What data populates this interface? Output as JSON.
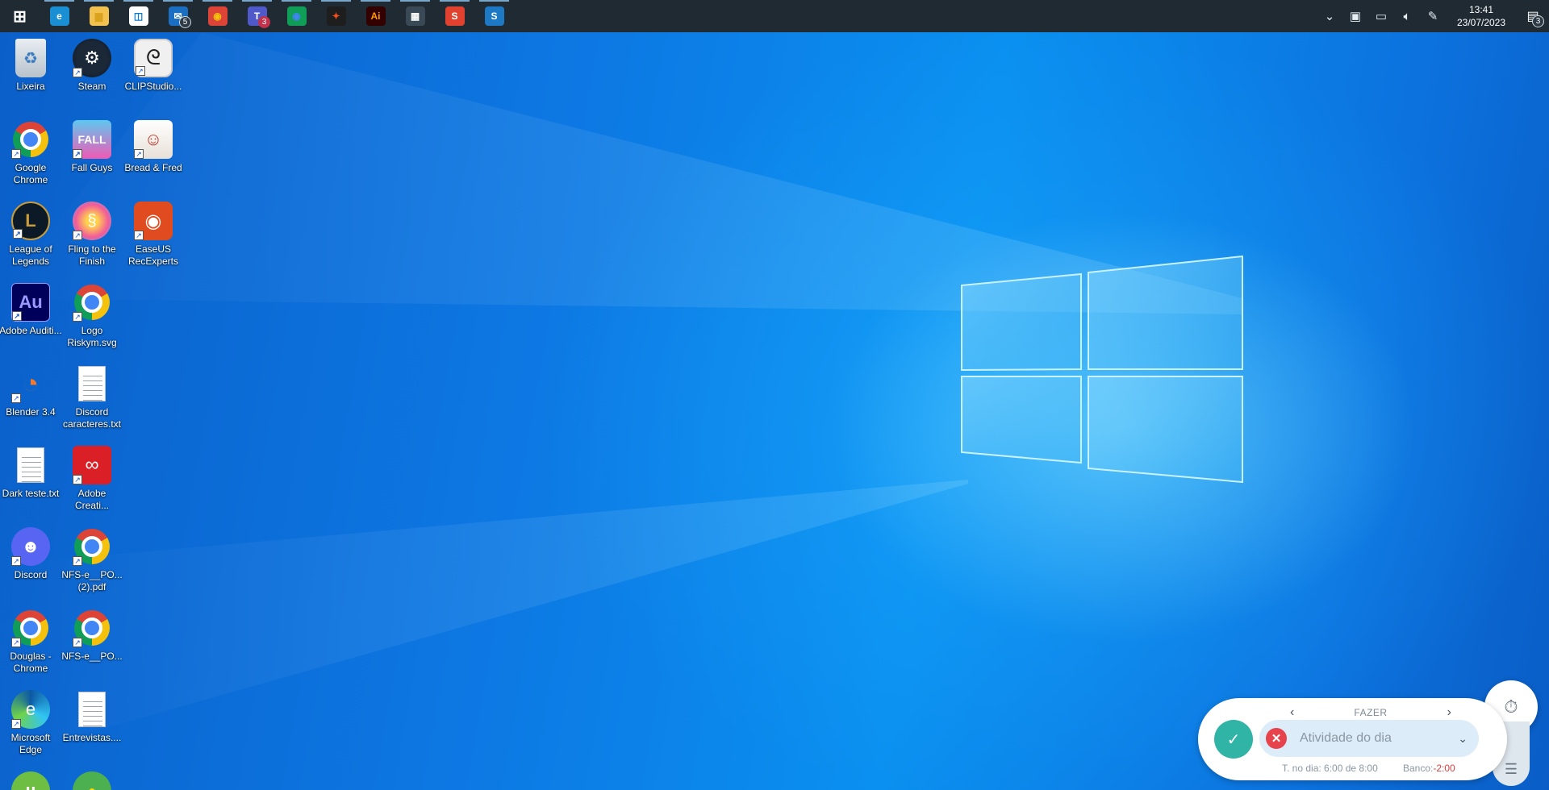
{
  "taskbar": {
    "apps": [
      {
        "name": "start-button-icon",
        "glyph": "⊞",
        "bg": "transparent",
        "color": "#ffffff"
      },
      {
        "name": "edge-icon",
        "glyph": "e",
        "bg": "#1b8fd3",
        "color": "#ffffff"
      },
      {
        "name": "file-explorer-icon",
        "glyph": "▆",
        "bg": "#f2c14e",
        "color": "#d9a21f"
      },
      {
        "name": "store-icon",
        "glyph": "◫",
        "bg": "#ffffff",
        "color": "#0078d4"
      },
      {
        "name": "mail-icon",
        "glyph": "✉",
        "bg": "#1b6fc2",
        "color": "#ffffff",
        "badge": "5"
      },
      {
        "name": "chrome-profile-icon",
        "glyph": "◉",
        "bg": "#db4437",
        "color": "#f4c20d"
      },
      {
        "name": "teams-icon",
        "glyph": "T",
        "bg": "#5059c9",
        "color": "#ffffff",
        "badge": "3",
        "badge_red": true
      },
      {
        "name": "chrome-icon",
        "glyph": "◉",
        "bg": "#0f9d58",
        "color": "#4285f4"
      },
      {
        "name": "figma-icon",
        "glyph": "✦",
        "bg": "#1e1e1e",
        "color": "#f24e1e"
      },
      {
        "name": "illustrator-icon",
        "glyph": "Ai",
        "bg": "#330000",
        "color": "#ff9a00"
      },
      {
        "name": "calculator-icon",
        "glyph": "▦",
        "bg": "#3a4956",
        "color": "#ffffff"
      },
      {
        "name": "app-s-red-icon",
        "glyph": "S",
        "bg": "#e1422f",
        "color": "#ffffff"
      },
      {
        "name": "app-s-blue-icon",
        "glyph": "S",
        "bg": "#1d79c4",
        "color": "#ffffff"
      }
    ],
    "tray": {
      "clock_time": "13:41",
      "clock_date": "23/07/2023",
      "notification_badge": "3"
    }
  },
  "desktop_icons": [
    {
      "label": "Lixeira",
      "kind": "recycle"
    },
    {
      "label": "Steam",
      "kind": "steam"
    },
    {
      "label": "CLIPStudio...",
      "kind": "clip"
    },
    {
      "label": "Google Chrome",
      "kind": "chrome"
    },
    {
      "label": "Fall Guys",
      "kind": "fallguys"
    },
    {
      "label": "Bread & Fred",
      "kind": "bread"
    },
    {
      "label": "League of Legends",
      "kind": "lol"
    },
    {
      "label": "Fling to the Finish",
      "kind": "fling"
    },
    {
      "label": "EaseUS RecExperts",
      "kind": "easeus"
    },
    {
      "label": "Adobe Auditi...",
      "kind": "audition"
    },
    {
      "label": "Logo Riskym.svg",
      "kind": "chrome"
    },
    {
      "label": "Blender 3.4",
      "kind": "blender"
    },
    {
      "label": "Discord caracteres.txt",
      "kind": "txt"
    },
    {
      "label": "Dark teste.txt",
      "kind": "txt"
    },
    {
      "label": "Adobe Creati...",
      "kind": "creative"
    },
    {
      "label": "Discord",
      "kind": "discord"
    },
    {
      "label": "NFS-e__PO... (2).pdf",
      "kind": "chrome"
    },
    {
      "label": "Douglas - Chrome",
      "kind": "chrome"
    },
    {
      "label": "NFS-e__PO...",
      "kind": "chrome"
    },
    {
      "label": "Microsoft Edge",
      "kind": "edge"
    },
    {
      "label": "Entrevistas....",
      "kind": "txt"
    },
    {
      "label": "",
      "kind": "utorrent"
    },
    {
      "label": "",
      "kind": "greenapp"
    }
  ],
  "widget": {
    "nav_label": "FAZER",
    "activity_placeholder": "Atividade do dia",
    "hours_text": "T. no dia: 6:00 de 8:00",
    "bank_label": "Banco:",
    "bank_value": "-2:00"
  }
}
